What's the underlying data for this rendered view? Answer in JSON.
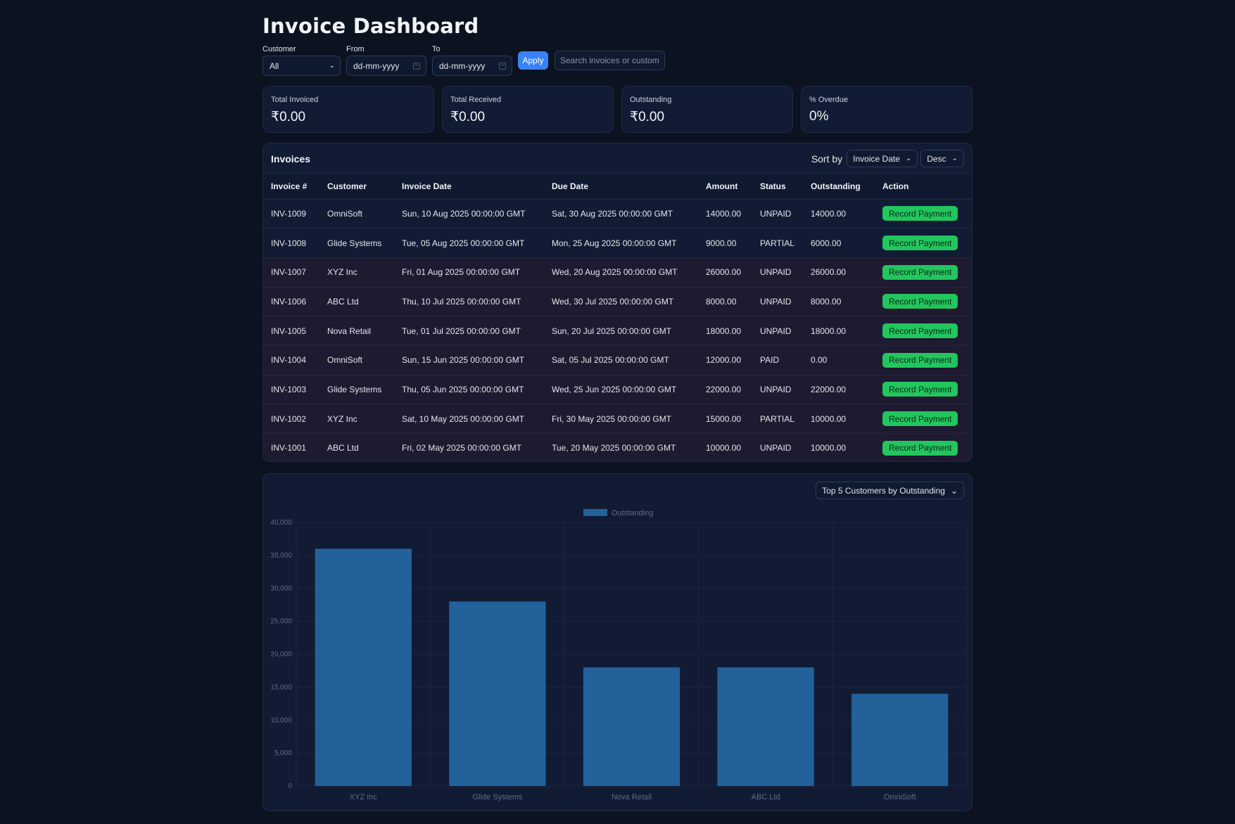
{
  "page": {
    "title": "Invoice Dashboard"
  },
  "filters": {
    "customer_label": "Customer",
    "customer_value": "All",
    "from_label": "From",
    "from_placeholder": "dd-mm-yyyy",
    "to_label": "To",
    "to_placeholder": "dd-mm-yyyy",
    "apply_label": "Apply",
    "search_placeholder": "Search invoices or customers"
  },
  "kpis": [
    {
      "label": "Total Invoiced",
      "value": "₹0.00"
    },
    {
      "label": "Total Received",
      "value": "₹0.00"
    },
    {
      "label": "Outstanding",
      "value": "₹0.00"
    },
    {
      "label": "% Overdue",
      "value": "0%"
    }
  ],
  "invoices": {
    "title": "Invoices",
    "sort_label": "Sort by",
    "sort_field": "Invoice Date",
    "sort_order": "Desc",
    "columns": [
      "Invoice #",
      "Customer",
      "Invoice Date",
      "Due Date",
      "Amount",
      "Status",
      "Outstanding",
      "Action"
    ],
    "action_label": "Record Payment",
    "rows": [
      [
        "INV-1009",
        "OmniSoft",
        "Sun, 10 Aug 2025 00:00:00 GMT",
        "Sat, 30 Aug 2025 00:00:00 GMT",
        "14000.00",
        "UNPAID",
        "14000.00"
      ],
      [
        "INV-1008",
        "Glide Systems",
        "Tue, 05 Aug 2025 00:00:00 GMT",
        "Mon, 25 Aug 2025 00:00:00 GMT",
        "9000.00",
        "PARTIAL",
        "6000.00"
      ],
      [
        "INV-1007",
        "XYZ Inc",
        "Fri, 01 Aug 2025 00:00:00 GMT",
        "Wed, 20 Aug 2025 00:00:00 GMT",
        "26000.00",
        "UNPAID",
        "26000.00"
      ],
      [
        "INV-1006",
        "ABC Ltd",
        "Thu, 10 Jul 2025 00:00:00 GMT",
        "Wed, 30 Jul 2025 00:00:00 GMT",
        "8000.00",
        "UNPAID",
        "8000.00"
      ],
      [
        "INV-1005",
        "Nova Retail",
        "Tue, 01 Jul 2025 00:00:00 GMT",
        "Sun, 20 Jul 2025 00:00:00 GMT",
        "18000.00",
        "UNPAID",
        "18000.00"
      ],
      [
        "INV-1004",
        "OmniSoft",
        "Sun, 15 Jun 2025 00:00:00 GMT",
        "Sat, 05 Jul 2025 00:00:00 GMT",
        "12000.00",
        "PAID",
        "0.00"
      ],
      [
        "INV-1003",
        "Glide Systems",
        "Thu, 05 Jun 2025 00:00:00 GMT",
        "Wed, 25 Jun 2025 00:00:00 GMT",
        "22000.00",
        "UNPAID",
        "22000.00"
      ],
      [
        "INV-1002",
        "XYZ Inc",
        "Sat, 10 May 2025 00:00:00 GMT",
        "Fri, 30 May 2025 00:00:00 GMT",
        "15000.00",
        "PARTIAL",
        "10000.00"
      ],
      [
        "INV-1001",
        "ABC Ltd",
        "Fri, 02 May 2025 00:00:00 GMT",
        "Tue, 20 May 2025 00:00:00 GMT",
        "10000.00",
        "UNPAID",
        "10000.00"
      ]
    ],
    "row_shading": [
      "a",
      "a",
      "b",
      "b",
      "b",
      "b",
      "b",
      "b",
      "b"
    ]
  },
  "chart_selector": "Top 5 Customers by Outstanding",
  "chart_data": {
    "type": "bar",
    "categories": [
      "XYZ Inc",
      "Glide Systems",
      "Nova Retail",
      "ABC Ltd",
      "OmniSoft"
    ],
    "series": [
      {
        "name": "Outstanding",
        "values": [
          36000,
          28000,
          18000,
          18000,
          14000
        ]
      }
    ],
    "ylim": [
      0,
      40000
    ],
    "yticks": [
      "0",
      "5,000",
      "10,000",
      "15,000",
      "20,000",
      "25,000",
      "30,000",
      "35,000",
      "40,000"
    ],
    "legend": "top-center",
    "grid": true,
    "bar_color": "#22619a",
    "title": "",
    "xlabel": "",
    "ylabel": ""
  },
  "colors": {
    "background": "#0b1220",
    "card": "#111c34",
    "accent": "#3b82f6",
    "action": "#22c55e"
  }
}
